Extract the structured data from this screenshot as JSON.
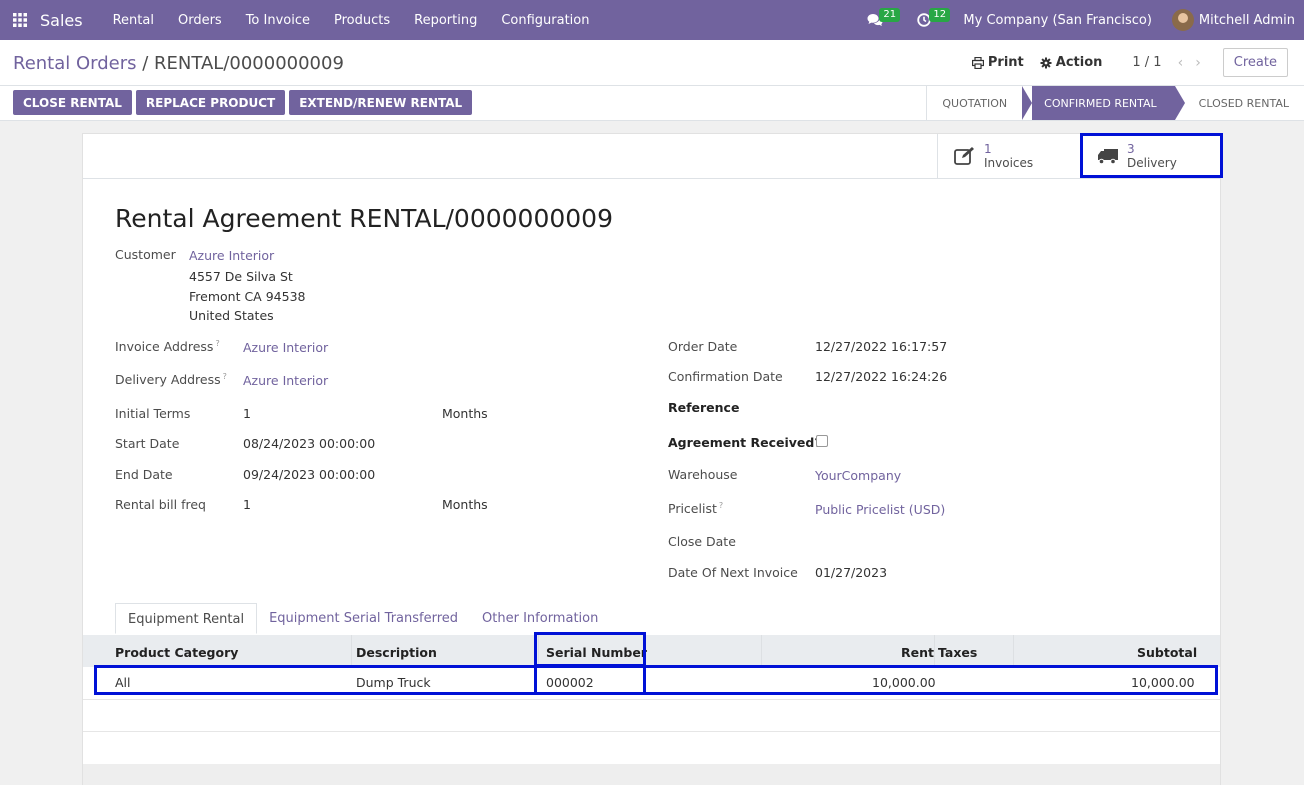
{
  "nav": {
    "app_name": "Sales",
    "menu": [
      "Rental",
      "Orders",
      "To Invoice",
      "Products",
      "Reporting",
      "Configuration"
    ],
    "messages_count": "21",
    "activities_count": "12",
    "company": "My Company (San Francisco)",
    "user": "Mitchell Admin"
  },
  "breadcrumb": {
    "parent": "Rental Orders",
    "separator": " / ",
    "current": "RENTAL/0000000009"
  },
  "toolbar": {
    "print": "Print",
    "action": "Action",
    "pager": "1 / 1",
    "create": "Create"
  },
  "actions": [
    "CLOSE RENTAL",
    "REPLACE PRODUCT",
    "EXTEND/RENEW RENTAL"
  ],
  "statusbar": [
    "QUOTATION",
    "CONFIRMED RENTAL",
    "CLOSED RENTAL"
  ],
  "smart_buttons": {
    "invoices": {
      "count": "1",
      "label": "Invoices"
    },
    "delivery": {
      "count": "3",
      "label": "Delivery"
    }
  },
  "form": {
    "title": "Rental Agreement RENTAL/0000000009",
    "customer_label": "Customer",
    "customer_name": "Azure Interior",
    "address_line1": "4557 De Silva St",
    "address_line2": "Fremont CA 94538",
    "address_line3": "United States",
    "invoice_address_label": "Invoice Address",
    "invoice_address": "Azure Interior",
    "delivery_address_label": "Delivery Address",
    "delivery_address": "Azure Interior",
    "initial_terms_label": "Initial Terms",
    "initial_terms": "1",
    "initial_terms_unit": "Months",
    "start_date_label": "Start Date",
    "start_date": "08/24/2023 00:00:00",
    "end_date_label": "End Date",
    "end_date": "09/24/2023 00:00:00",
    "bill_freq_label": "Rental bill freq",
    "bill_freq": "1",
    "bill_freq_unit": "Months",
    "order_date_label": "Order Date",
    "order_date": "12/27/2022 16:17:57",
    "confirmation_date_label": "Confirmation Date",
    "confirmation_date": "12/27/2022 16:24:26",
    "reference_label": "Reference",
    "agreement_label": "Agreement Received?",
    "warehouse_label": "Warehouse",
    "warehouse": "YourCompany",
    "pricelist_label": "Pricelist",
    "pricelist": "Public Pricelist (USD)",
    "close_date_label": "Close Date",
    "next_invoice_label": "Date Of Next Invoice",
    "next_invoice": "01/27/2023",
    "help_mark": "?"
  },
  "tabs": [
    "Equipment Rental",
    "Equipment Serial Transferred",
    "Other Information"
  ],
  "table": {
    "headers": [
      "Product Category",
      "Description",
      "Serial Number",
      "Rent",
      "Taxes",
      "Subtotal"
    ],
    "rows": [
      {
        "category": "All",
        "description": "Dump Truck",
        "serial": "000002",
        "rent": "10,000.00",
        "taxes": "",
        "subtotal": "10,000.00"
      }
    ]
  }
}
